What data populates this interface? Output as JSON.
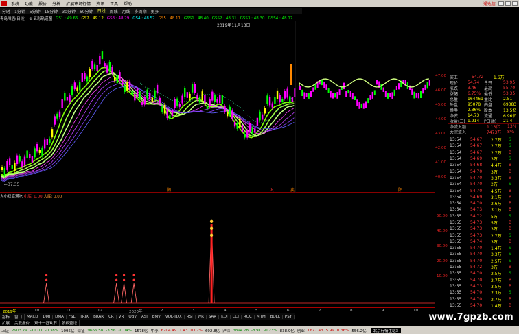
{
  "menu": {
    "items": [
      "系统",
      "功能",
      "报价",
      "分析",
      "扩展市场行情",
      "资讯",
      "工具",
      "帮助"
    ],
    "brand": "通达信"
  },
  "periods": [
    "分时",
    "1分钟",
    "5分钟",
    "15分钟",
    "30分钟",
    "60分钟",
    "日线",
    "周线",
    "月线",
    "多周期",
    "更多"
  ],
  "periods_selected_index": 6,
  "ma_line": [
    "青岛啤酒(日线)",
    "⊕ 五彩轨道图",
    "GS1 : 49.65",
    "GS2 : 49.12",
    "GS3 : 48.29",
    "GS4 : 48.52",
    "GS5 : 48.11",
    "GSS1 : 48.40",
    "GSS2 : 48.31",
    "GSS3 : 48.30",
    "GSS4 : 48.17",
    "GSS5 : 48.47"
  ],
  "ma_colors": [
    "#ddd",
    "#ddd",
    "#0f0",
    "#ff0",
    "#f0f",
    "#0ff",
    "#f80",
    "#0f0",
    "#0f0",
    "#0f0",
    "#0f0",
    "#0f0"
  ],
  "cursor_date": "2019年11月13日",
  "cursor_price": "←37.35",
  "main_marks": [
    "阳",
    "入",
    "卖",
    "阳"
  ],
  "price_axis": [
    "47.00",
    "46.00",
    "45.00",
    "44.00",
    "43.00",
    "42.00",
    "41.00",
    "40.00"
  ],
  "sub_indicator": {
    "name": "大小双底通吃",
    "field1_label": "小底:",
    "field1_value": "0.00",
    "field2_label": "大底:",
    "field2_value": "0.00"
  },
  "sub_axis": [
    "50.00",
    "40.00",
    "30.00",
    "20.00",
    "10.00"
  ],
  "x_axis": [
    "2019年",
    "10",
    "11",
    "12",
    "2020年",
    "2",
    "3",
    "4",
    "5",
    "6",
    "7",
    "8",
    "9",
    "10"
  ],
  "indicator_tabs": [
    "指标",
    "窗口",
    "MACD",
    "DMI",
    "DMA",
    "FSL",
    "TRIX",
    "BRAR",
    "CR",
    "VR",
    "OBV",
    "ASI",
    "EMV",
    "VOL-TDX",
    "RSI",
    "WR",
    "SAR",
    "KDJ",
    "CCI",
    "ROC",
    "MTM",
    "BOLL",
    "PSY",
    "MCST",
    "SCR",
    "更多",
    "设置"
  ],
  "indicator_tab_active": "设置",
  "window_tabs": [
    "扩展",
    "关联报价",
    "双十一狂欢节",
    "股权登记"
  ],
  "quote": {
    "sell2": {
      "label": "卖二",
      "price": "",
      "vol": ""
    },
    "buy1": {
      "label": "买五",
      "price": "54.72",
      "vol": "1.6万"
    },
    "rows": [
      {
        "l1": "现价",
        "v1": "54.74",
        "l2": "今开",
        "v2": "53.95"
      },
      {
        "l1": "涨跌",
        "v1": "3.46",
        "l2": "最高",
        "v2": "55.70"
      },
      {
        "l1": "涨幅",
        "v1": "6.75%",
        "l2": "最低",
        "v2": "53.35"
      },
      {
        "l1": "总量",
        "v1": "164461",
        "l2": "量比",
        "v2": "2.51"
      },
      {
        "l1": "外盘",
        "v1": "95078",
        "l2": "内盘",
        "v2": "69383"
      },
      {
        "l1": "换手",
        "v1": "2.36%",
        "l2": "股本",
        "v2": "13.5亿"
      },
      {
        "l1": "净资",
        "v1": "14.73",
        "l2": "流通",
        "v2": "6.96亿"
      },
      {
        "l1": "收益(二)",
        "v1": "1.914",
        "l2": "PE(动)",
        "v2": "21.4"
      }
    ],
    "flow": [
      {
        "label": "净流入额",
        "value": "1.13亿",
        "pct": "13%"
      },
      {
        "label": "大宗流入",
        "value": "7473万",
        "pct": "8%"
      }
    ]
  },
  "ticks": [
    {
      "t": "13:54",
      "p": "54.67",
      "v": "2.7万",
      "s": "S"
    },
    {
      "t": "13:54",
      "p": "54.67",
      "v": "2.7万",
      "s": "S"
    },
    {
      "t": "13:54",
      "p": "54.67",
      "v": "2.7万",
      "s": "B"
    },
    {
      "t": "13:54",
      "p": "54.69",
      "v": "3万",
      "s": "S"
    },
    {
      "t": "13:54",
      "p": "54.68",
      "v": "4.4万",
      "s": "B"
    },
    {
      "t": "13:54",
      "p": "54.70",
      "v": "3万",
      "s": "B"
    },
    {
      "t": "13:54",
      "p": "54.70",
      "v": "3.3万",
      "s": "B"
    },
    {
      "t": "13:54",
      "p": "54.70",
      "v": "2万",
      "s": "S"
    },
    {
      "t": "13:54",
      "p": "54.70",
      "v": "4.5万",
      "s": "B"
    },
    {
      "t": "13:54",
      "p": "54.69",
      "v": "3.1万",
      "s": "B"
    },
    {
      "t": "13:54",
      "p": "54.70",
      "v": "2.6万",
      "s": "B"
    },
    {
      "t": "13:54",
      "p": "54.73",
      "v": "3.1万",
      "s": "B"
    },
    {
      "t": "13:55",
      "p": "54.72",
      "v": "5万",
      "s": "S"
    },
    {
      "t": "13:55",
      "p": "54.73",
      "v": "5万",
      "s": "B"
    },
    {
      "t": "13:55",
      "p": "54.73",
      "v": "3万",
      "s": "B"
    },
    {
      "t": "13:55",
      "p": "54.73",
      "v": "2.7万",
      "s": "S"
    },
    {
      "t": "13:55",
      "p": "54.74",
      "v": "3万",
      "s": "B"
    },
    {
      "t": "13:55",
      "p": "54.70",
      "v": "1.4万",
      "s": "S"
    },
    {
      "t": "13:55",
      "p": "54.70",
      "v": "3.3万",
      "s": "S"
    },
    {
      "t": "13:55",
      "p": "54.70",
      "v": "2.5万",
      "s": "S"
    },
    {
      "t": "13:55",
      "p": "54.72",
      "v": "3万",
      "s": "B"
    },
    {
      "t": "13:55",
      "p": "54.70",
      "v": "2.5万",
      "s": "S"
    },
    {
      "t": "13:55",
      "p": "54.70",
      "v": "2.7万",
      "s": "B"
    },
    {
      "t": "13:55",
      "p": "54.73",
      "v": "3.5万",
      "s": "B"
    },
    {
      "t": "13:55",
      "p": "54.70",
      "v": "2.3万",
      "s": "S"
    },
    {
      "t": "13:55",
      "p": "54.70",
      "v": "2.7万",
      "s": "B"
    },
    {
      "t": "13:55",
      "p": "54.70",
      "v": "1.4万",
      "s": "B"
    }
  ],
  "status": {
    "items": [
      {
        "name": "上证",
        "val": "2903.79",
        "chg": "-11.03",
        "pct": "-0.38%",
        "amt": "1095亿",
        "dir": "dn"
      },
      {
        "name": "深证",
        "val": "9666.58",
        "chg": "-3.56",
        "pct": "-0.04%",
        "amt": "1578亿",
        "dir": "dn"
      },
      {
        "name": "中小",
        "val": "6204.49",
        "chg": "1.43",
        "pct": "0.02%",
        "amt": "692.8亿",
        "dir": "up"
      },
      {
        "name": "沪深",
        "val": "3894.78",
        "chg": "-8.91",
        "pct": "-0.23%",
        "amt": "838.9亿",
        "dir": "dn"
      },
      {
        "name": "创业",
        "val": "1677.43",
        "chg": "5.99",
        "pct": "0.36%",
        "amt": "556.2亿",
        "dir": "up"
      }
    ],
    "broker": "北京行情主站3"
  },
  "watermark": "www.7gpzb.com",
  "chart_data": {
    "type": "candlestick",
    "price_axis_ticks": [
      47,
      46,
      45,
      44,
      43,
      42,
      41,
      40
    ],
    "sub_indicator_peaks": [
      {
        "x_index": 18,
        "value": 12
      },
      {
        "x_index": 46,
        "value": 12
      },
      {
        "x_index": 49,
        "value": 12
      },
      {
        "x_index": 53,
        "value": 12
      },
      {
        "x_index": 84,
        "value": 48
      }
    ]
  }
}
